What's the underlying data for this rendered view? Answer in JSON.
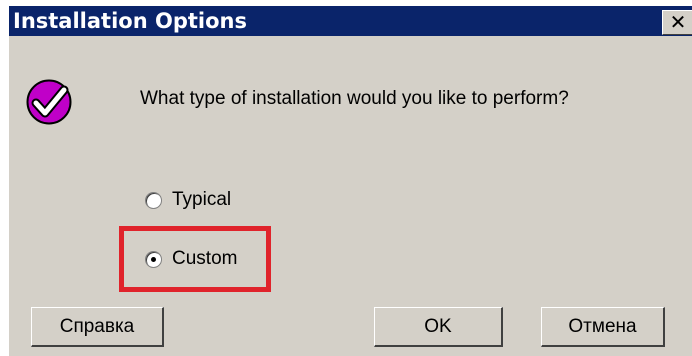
{
  "window": {
    "title": "Installation Options",
    "close_glyph": "✕"
  },
  "icon": "checkmark-icon",
  "question": "What type of installation would you like to perform?",
  "options": [
    {
      "label": "Typical",
      "selected": false
    },
    {
      "label": "Custom",
      "selected": true
    }
  ],
  "buttons": {
    "help": "Справка",
    "ok": "OK",
    "cancel": "Отмена"
  },
  "colors": {
    "titlebar": "#0a246a",
    "dialog_face": "#d4d0c8",
    "icon_purple": "#c000c8",
    "highlight": "#e0232b"
  }
}
